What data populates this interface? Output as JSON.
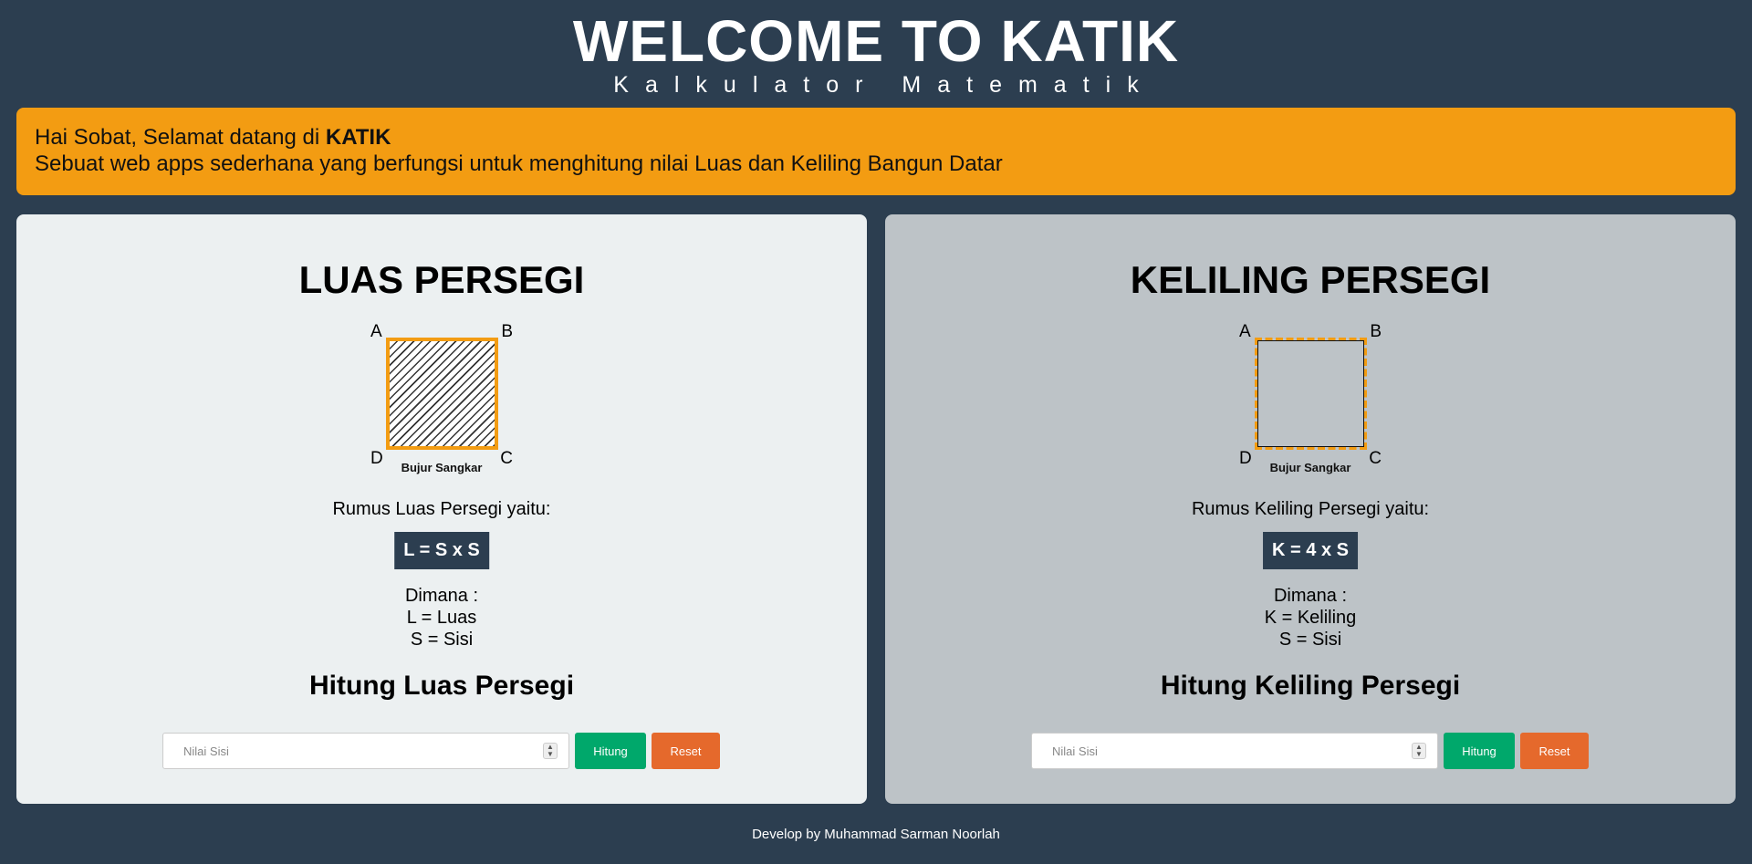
{
  "header": {
    "title": "WELCOME TO KATIK",
    "subtitle": "Kalkulator Matematik"
  },
  "banner": {
    "greeting_prefix": "Hai Sobat, Selamat datang di ",
    "greeting_brand": "KATIK",
    "description": "Sebuat web apps sederhana yang berfungsi untuk menghitung nilai Luas dan Keliling Bangun Datar",
    "color": "#f39c12"
  },
  "luas": {
    "title": "LUAS PERSEGI",
    "labels": {
      "a": "A",
      "b": "B",
      "c": "C",
      "d": "D"
    },
    "caption": "Bujur Sangkar",
    "formula_intro": "Rumus Luas Persegi yaitu:",
    "formula": "L = S x S",
    "where_title": "Dimana :",
    "where_1": "L = Luas",
    "where_2": "S = Sisi",
    "calc_title": "Hitung Luas Persegi",
    "input_placeholder": "Nilai Sisi",
    "hitung_label": "Hitung",
    "reset_label": "Reset"
  },
  "keliling": {
    "title": "KELILING PERSEGI",
    "labels": {
      "a": "A",
      "b": "B",
      "c": "C",
      "d": "D"
    },
    "caption": "Bujur Sangkar",
    "formula_intro": "Rumus Keliling Persegi yaitu:",
    "formula": "K = 4 x S",
    "where_title": "Dimana :",
    "where_1": "K = Keliling",
    "where_2": "S = Sisi",
    "calc_title": "Hitung Keliling Persegi",
    "input_placeholder": "Nilai Sisi",
    "hitung_label": "Hitung",
    "reset_label": "Reset"
  },
  "footer": {
    "text": "Develop by Muhammad Sarman Noorlah"
  },
  "colors": {
    "background": "#2c3e50",
    "accent": "#f39c12",
    "hitung": "#00a86b",
    "reset": "#e5692c"
  }
}
